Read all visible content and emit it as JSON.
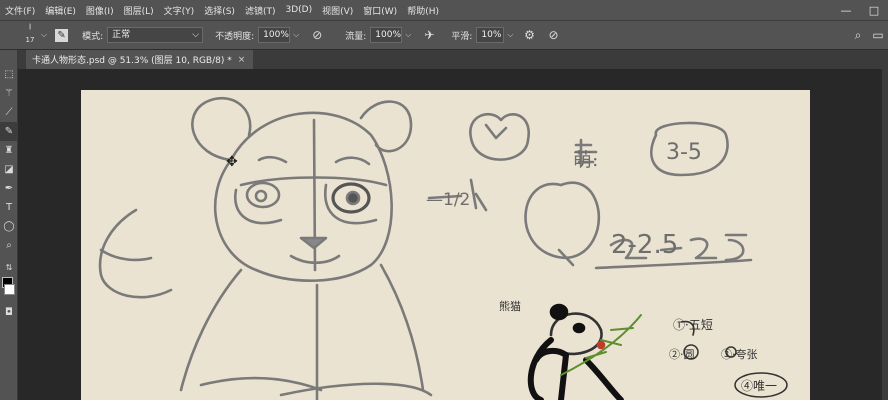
{
  "menu": {
    "items": [
      "文件(F)",
      "编辑(E)",
      "图像(I)",
      "图层(L)",
      "文字(Y)",
      "选择(S)",
      "滤镜(T)",
      "3D(D)",
      "视图(V)",
      "窗口(W)",
      "帮助(H)"
    ]
  },
  "window_controls": {
    "minimize": "—",
    "maximize": "□"
  },
  "options_bar": {
    "brush_size": "17",
    "mode_label": "模式:",
    "mode_value": "正常",
    "opacity_label": "不透明度:",
    "opacity_value": "100%",
    "flow_label": "流量:",
    "flow_value": "100%",
    "smoothing_label": "平滑:",
    "smoothing_value": "10%"
  },
  "document": {
    "tab_title": "卡通人物形态.psd @ 51.3% (图层 10, RGB/8) *",
    "tab_close": "×"
  },
  "sketch_text": {
    "ratio_1": "—1/2",
    "head_label": "萌:",
    "range_1": "3-5",
    "range_2": "2-2.5",
    "panda_label": "熊猫",
    "note_1": "①·五短",
    "note_2": "②·圆",
    "note_3": "③·夸张",
    "note_4": "④唯一"
  },
  "colors": {
    "canvas": "#ebe3d1",
    "workspace": "#282828",
    "panel": "#535353",
    "pencil": "#7a7a7a",
    "accent_red": "#c23a2b",
    "accent_green": "#5e8f2e"
  }
}
